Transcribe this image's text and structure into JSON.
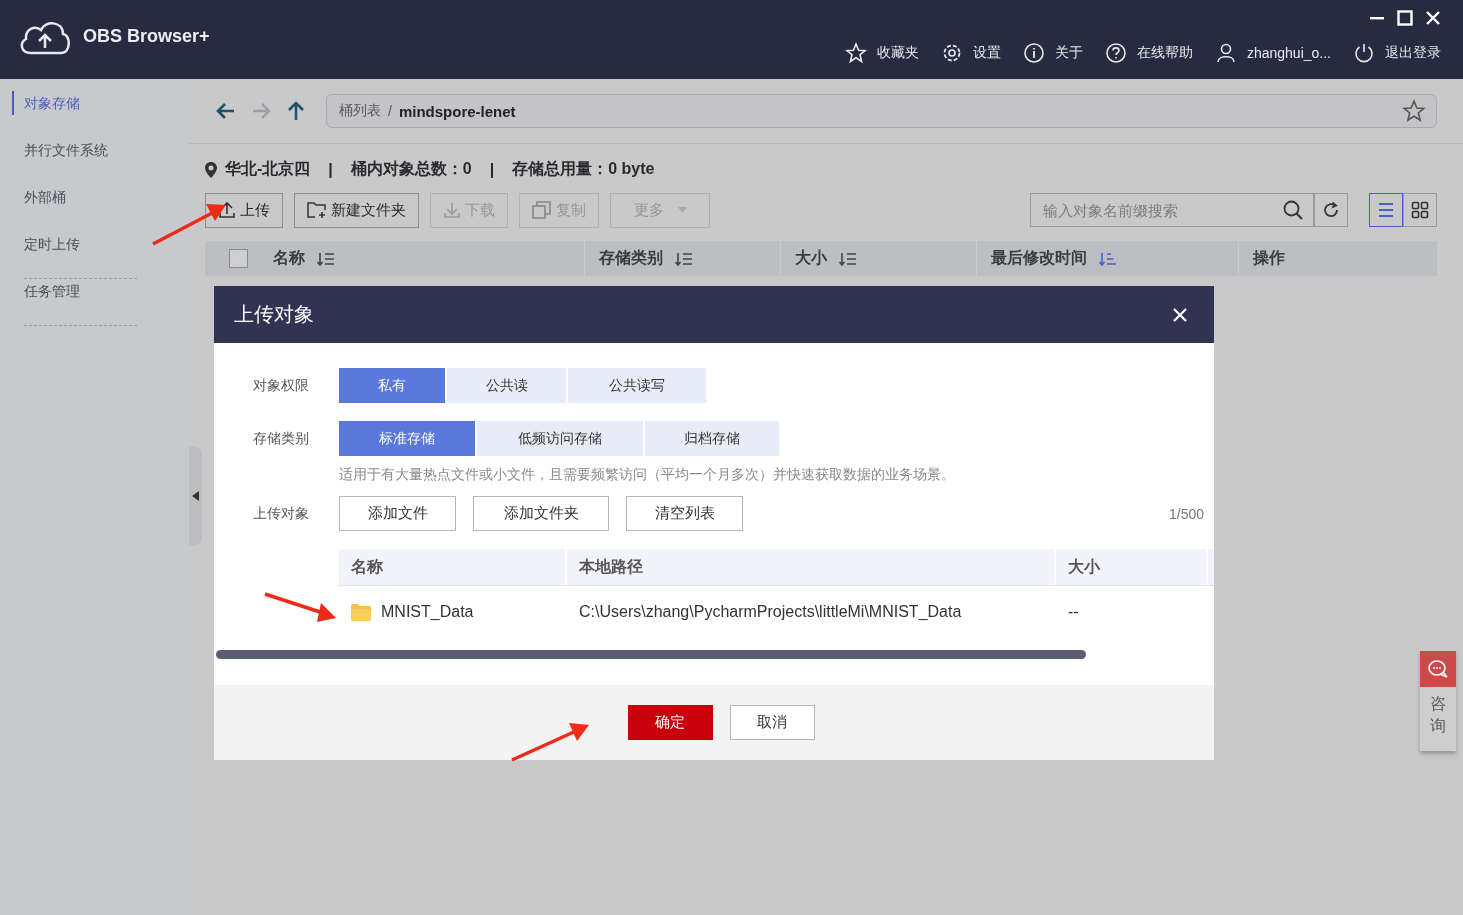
{
  "app": {
    "title": "OBS Browser+"
  },
  "top_menu": [
    {
      "kind": "star",
      "label": "收藏夹"
    },
    {
      "kind": "gear",
      "label": "设置"
    },
    {
      "kind": "info",
      "label": "关于"
    },
    {
      "kind": "help",
      "label": "在线帮助"
    },
    {
      "kind": "user",
      "label": "zhanghui_o..."
    },
    {
      "kind": "power",
      "label": "退出登录"
    }
  ],
  "sidebar": {
    "items": [
      {
        "label": "对象存储",
        "selected": true
      },
      {
        "label": "并行文件系统",
        "selected": false
      },
      {
        "label": "外部桶",
        "selected": false
      },
      {
        "label": "定时上传",
        "selected": false
      },
      {
        "label": "任务管理",
        "selected": false
      }
    ]
  },
  "breadcrumb": {
    "root": "桶列表",
    "separator": "/",
    "current": "mindspore-lenet"
  },
  "info": {
    "region": "华北-北京四",
    "separator": "|",
    "object_count": "桶内对象总数：0",
    "usage": "存储总用量：0 byte"
  },
  "toolbar": [
    {
      "kind": "upload",
      "label": "上传",
      "disabled": false
    },
    {
      "kind": "folder",
      "label": "新建文件夹",
      "disabled": false
    },
    {
      "kind": "download",
      "label": "下载",
      "disabled": true
    },
    {
      "kind": "copy",
      "label": "复制",
      "disabled": true
    },
    {
      "kind": "more",
      "label": "更多",
      "disabled": true
    }
  ],
  "search": {
    "placeholder": "输入对象名前缀搜索"
  },
  "views": [
    {
      "kind": "list",
      "selected": true
    },
    {
      "kind": "grid",
      "selected": false
    }
  ],
  "table": {
    "checked": false,
    "columns": [
      {
        "label": "名称",
        "sortable": true,
        "sorted": false
      },
      {
        "label": "存储类别",
        "sortable": true,
        "sorted": false
      },
      {
        "label": "大小",
        "sortable": true,
        "sorted": false
      },
      {
        "label": "最后修改时间",
        "sortable": true,
        "sorted": true
      },
      {
        "label": "操作",
        "sortable": false
      }
    ]
  },
  "dialog": {
    "title": "上传对象",
    "permission": {
      "label": "对象权限",
      "options": [
        {
          "label": "私有",
          "selected": true
        },
        {
          "label": "公共读",
          "selected": false
        },
        {
          "label": "公共读写",
          "selected": false
        }
      ]
    },
    "storage_class": {
      "label": "存储类别",
      "options": [
        {
          "label": "标准存储",
          "selected": true
        },
        {
          "label": "低频访问存储",
          "selected": false
        },
        {
          "label": "归档存储",
          "selected": false
        }
      ],
      "hint": "适用于有大量热点文件或小文件，且需要频繁访问（平均一个月多次）并快速获取数据的业务场景。"
    },
    "upload": {
      "label": "上传对象",
      "buttons": [
        "添加文件",
        "添加文件夹",
        "清空列表"
      ],
      "count": "1/500"
    },
    "columns": [
      "名称",
      "本地路径",
      "大小"
    ],
    "rows": [
      {
        "name": "MNIST_Data",
        "path": "C:\\Users\\zhang\\PycharmProjects\\littleMi\\MNIST_Data",
        "size": "--"
      }
    ],
    "buttons": [
      {
        "kind": "primary",
        "label": "确定"
      },
      {
        "kind": "default",
        "label": "取消"
      }
    ]
  },
  "consult": {
    "label": "咨询"
  }
}
